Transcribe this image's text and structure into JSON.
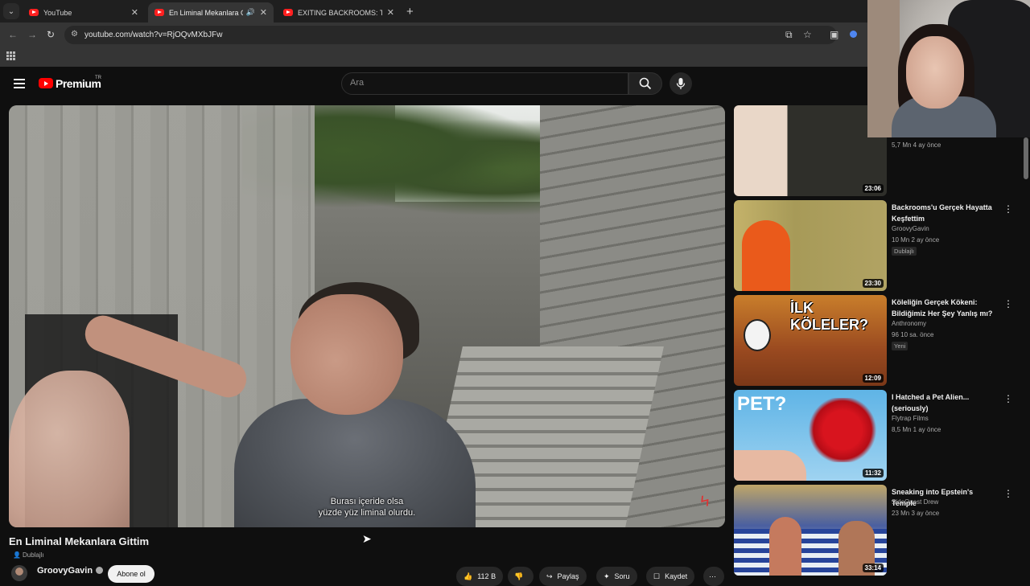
{
  "browser": {
    "tabs": [
      {
        "label": "YouTube",
        "active": false
      },
      {
        "label": "En Liminal Mekanlara Gittim",
        "active": true
      },
      {
        "label": "EXITING BACKROOMS: THE EN",
        "active": false
      }
    ],
    "url": "youtube.com/watch?v=RjOQvMXbJFw"
  },
  "header": {
    "brand": "Premium",
    "region": "TR",
    "search_placeholder": "Ara"
  },
  "player": {
    "subtitle_line1": "Burası içeride olsa",
    "subtitle_line2": "yüzde yüz liminal olurdu."
  },
  "video": {
    "title": "En Liminal Mekanlara Gittim",
    "dub_label": "Dublajlı",
    "channel": "GroovyGavin",
    "subscribe_label": "Abone ol",
    "like_count": "112 B",
    "share_label": "Paylaş",
    "ask_label": "Soru",
    "save_label": "Kaydet"
  },
  "recommendations": [
    {
      "title": "",
      "channel": "",
      "meta": "5,7 Mn   4 ay önce",
      "duration": "23:06",
      "badge": ""
    },
    {
      "title": "Backrooms'u Gerçek Hayatta Keşfettim",
      "channel": "GroovyGavin",
      "meta": "10 Mn   2 ay önce",
      "duration": "23:30",
      "badge": "Dublajlı"
    },
    {
      "title": "Köleliğin Gerçek Kökeni: Bildiğimiz Her Şey Yanlış mı?",
      "channel": "Anthronomy",
      "meta": "96   10 sa. önce",
      "duration": "12:09",
      "badge": "Yeni",
      "thumb_text": "İLK KÖLELER?"
    },
    {
      "title": "I Hatched a Pet Alien... (seriously)",
      "channel": "Flytrap Films",
      "meta": "8,5 Mn   1 ay önce",
      "duration": "11:32",
      "badge": "",
      "thumb_text": "PET?"
    },
    {
      "title": "Sneaking into Epstein's Temple",
      "channel": "SideQuest Drew",
      "meta": "23 Mn   3 ay önce",
      "duration": "33:14",
      "badge": ""
    }
  ]
}
